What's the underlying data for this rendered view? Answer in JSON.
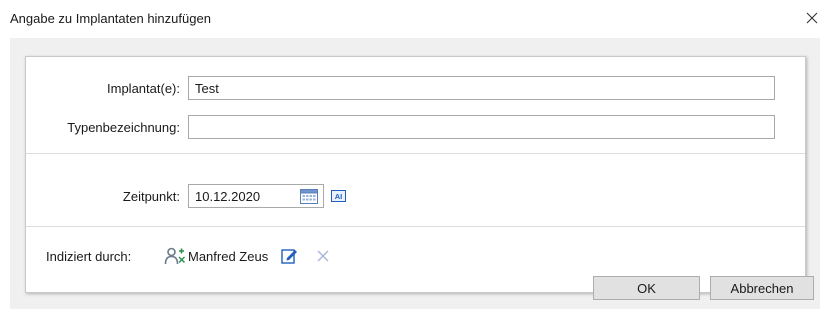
{
  "window": {
    "title": "Angabe zu Implantaten hinzufügen",
    "close_glyph": "✕"
  },
  "form": {
    "implant_label": "Implantat(e):",
    "implant_value": "Test",
    "type_label": "Typenbezeichnung:",
    "type_value": "",
    "time_label": "Zeitpunkt:",
    "date_value": "10.12.2020",
    "ai_icon_text": "AI",
    "indicated_label": "Indiziert durch:",
    "indicated_person": "Manfred Zeus"
  },
  "buttons": {
    "ok_label": "OK",
    "cancel_label": "Abbrechen"
  },
  "icons": {
    "close": "close-icon",
    "calendar": "calendar-icon",
    "ai": "ai-icon",
    "person": "person-icon",
    "edit": "edit-icon",
    "remove": "remove-icon"
  },
  "colors": {
    "accent_blue": "#1f5fbf",
    "muted_x": "#a8b8d8",
    "background_gray": "#f0f0f0"
  }
}
